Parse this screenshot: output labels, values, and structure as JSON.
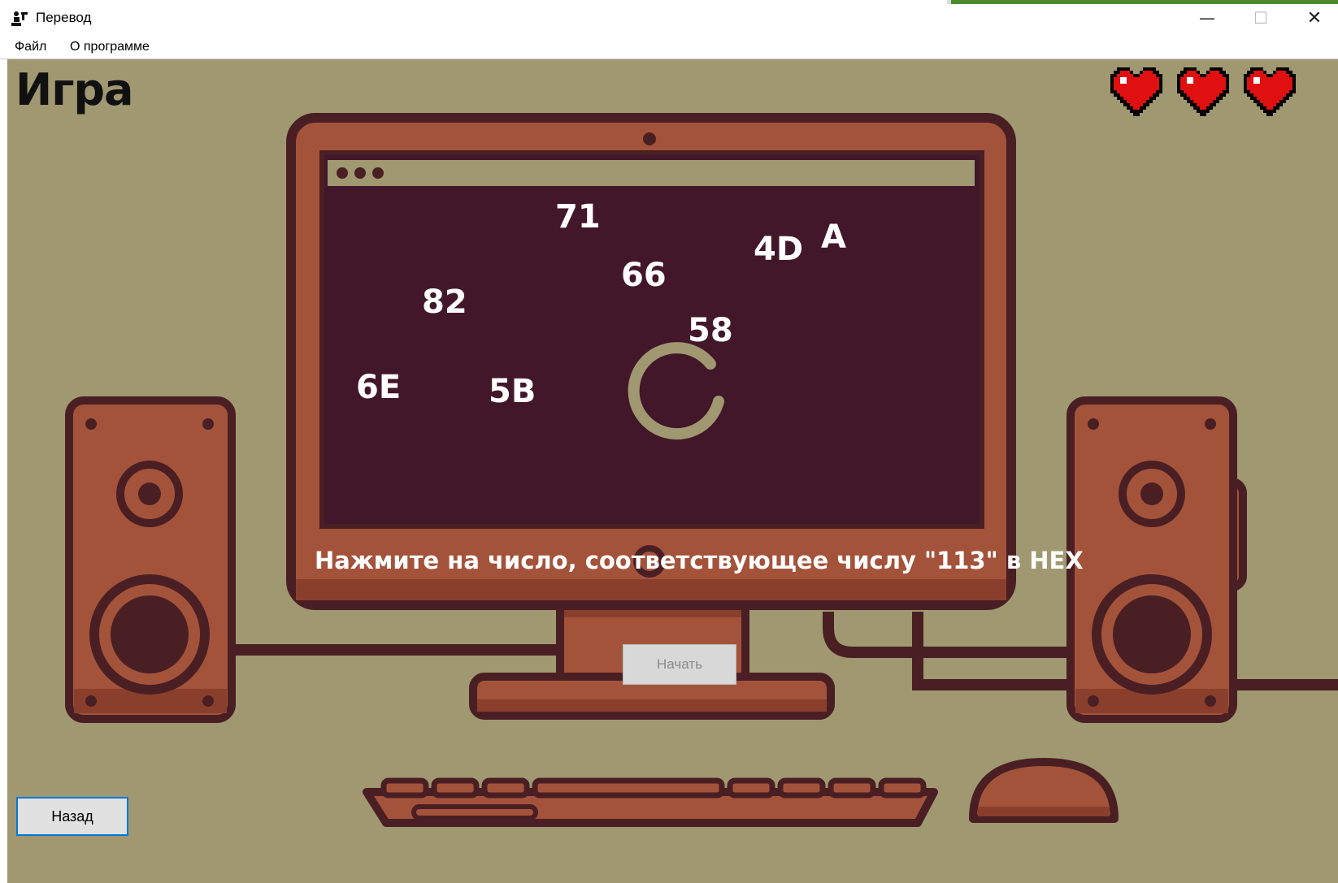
{
  "window": {
    "title": "Перевод",
    "icon": "pawn-icon",
    "controls": [
      "minimize",
      "maximize",
      "close"
    ]
  },
  "menu": {
    "items": [
      "Файл",
      "О программе"
    ]
  },
  "game": {
    "title": "Игра",
    "lives": 3,
    "numbers": [
      "71",
      "4D",
      "A",
      "66",
      "82",
      "58",
      "6E",
      "5B"
    ],
    "prompt": "Нажмите на число, соответствующее числу \"113\" в HEX",
    "start_label": "Начать",
    "back_label": "Назад"
  },
  "colors": {
    "background": "#a09870",
    "monitor": "#a4533b",
    "screen": "#43172a",
    "outline": "#4a1f24",
    "heart": "#e01010"
  }
}
